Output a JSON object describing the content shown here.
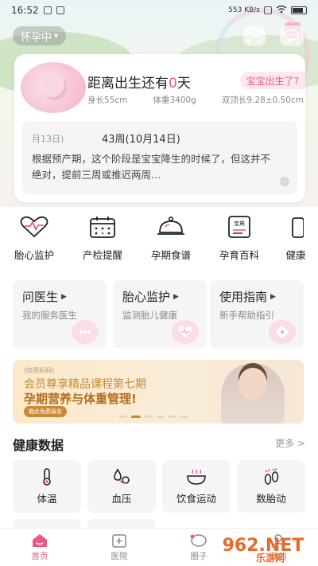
{
  "status_bar": {
    "time": "16:52",
    "net_speed": "553 KB/s"
  },
  "header": {
    "stage_label": "怀孕中"
  },
  "countdown": {
    "prefix": "距离出生还有",
    "days": "0",
    "suffix": "天",
    "born_tag": "宝宝出生了?",
    "length": "身长55cm",
    "weight": "体重3400g",
    "bpd": "双顶长9.28±0.50cm"
  },
  "week_info": {
    "date_label": "月13日)",
    "week": "43周(10月14日)",
    "text": "根据预产期，这个阶段是宝宝降生的时候了，但这并不绝对，提前三周或推迟两周…"
  },
  "shortcuts": [
    "胎心监护",
    "产检提醒",
    "孕期食谱",
    "孕育百科",
    "健康"
  ],
  "services": [
    {
      "title": "问医生",
      "sub": "我的服务医生"
    },
    {
      "title": "胎心监护",
      "sub": "监测胎儿健康"
    },
    {
      "title": "使用指南",
      "sub": "新手帮助指引"
    }
  ],
  "banner": {
    "small": "(仅限妈妈)",
    "line1": "会员尊享精品课程第七期",
    "line2": "孕期营养与体重管理!",
    "cta": "戳此免费报名"
  },
  "health": {
    "title": "健康数据",
    "more": "更多 >",
    "items": [
      "体温",
      "血压",
      "饮食运动",
      "数胎动"
    ]
  },
  "tabs": [
    {
      "label": "首页",
      "active": true
    },
    {
      "label": "医院",
      "active": false
    },
    {
      "label": "圈子",
      "active": false
    },
    {
      "label": "我的",
      "active": false
    }
  ],
  "watermark": {
    "brand": "962.NET",
    "sub": "乐游网"
  },
  "colors": {
    "accent": "#ec5a84",
    "gold": "#c98a36"
  }
}
